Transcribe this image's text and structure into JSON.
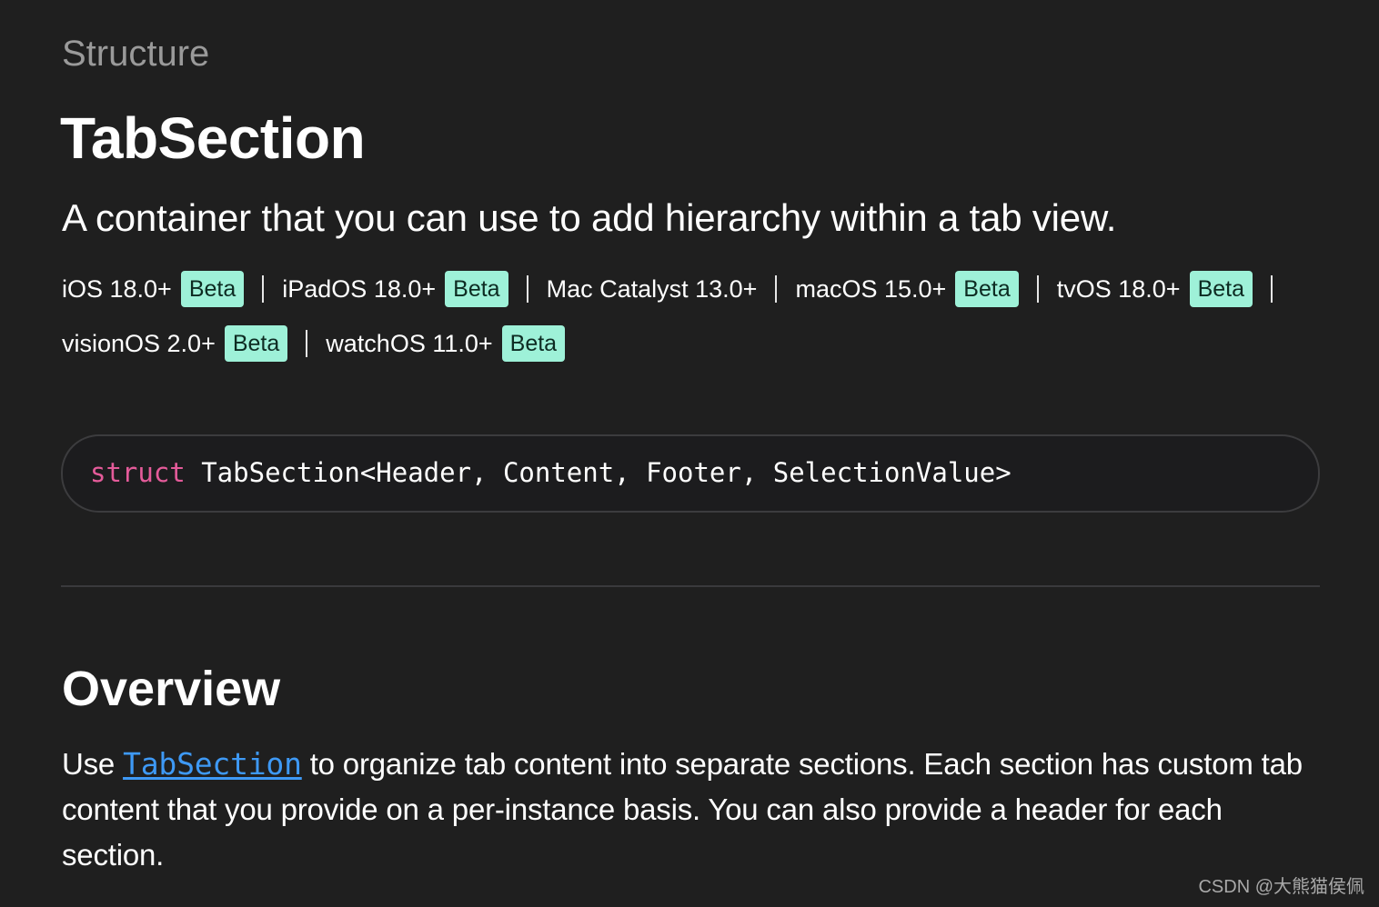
{
  "page": {
    "eyebrow": "Structure",
    "title": "TabSection",
    "abstract": "A container that you can use to add hierarchy within a tab view."
  },
  "platforms": {
    "rows": [
      [
        {
          "name": "iOS 18.0+",
          "badge": "Beta"
        },
        {
          "name": "iPadOS 18.0+",
          "badge": "Beta"
        },
        {
          "name": "Mac Catalyst 13.0+",
          "badge": ""
        },
        {
          "name": "macOS 15.0+",
          "badge": "Beta"
        },
        {
          "name": "tvOS 18.0+",
          "badge": "Beta"
        }
      ],
      [
        {
          "name": "visionOS 2.0+",
          "badge": "Beta"
        },
        {
          "name": "watchOS 11.0+",
          "badge": "Beta"
        }
      ]
    ]
  },
  "declaration": {
    "keyword": "struct",
    "signature": " TabSection<Header, Content, Footer, SelectionValue>"
  },
  "overview": {
    "heading": "Overview",
    "text_before": "Use ",
    "link_text": "TabSection",
    "text_after": " to organize tab content into separate sections. Each section has custom tab content that you provide on a per-instance basis. You can also provide a header for each section."
  },
  "watermark": "CSDN @大熊猫侯佩",
  "colors": {
    "background": "#1f1f1f",
    "badge": "#9ef1d8",
    "keyword": "#e45b9a",
    "link": "#3e99f5"
  }
}
